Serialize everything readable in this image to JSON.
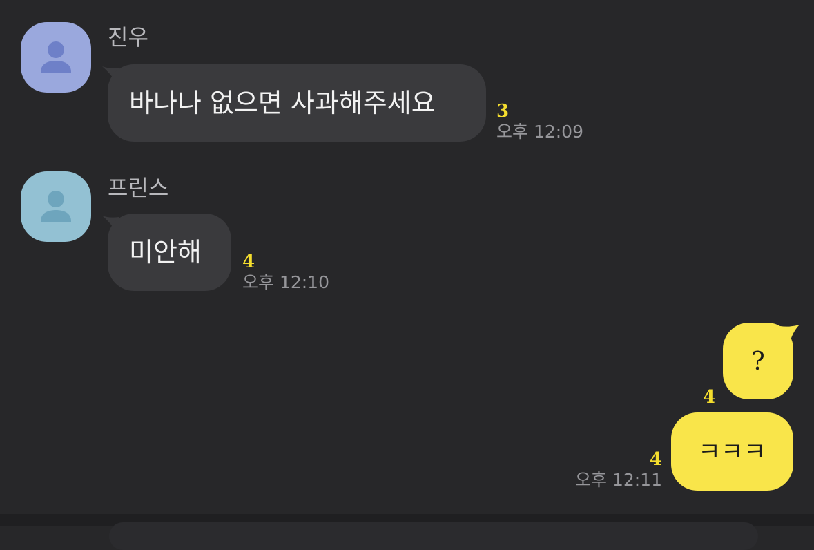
{
  "colors": {
    "background": "#272729",
    "incoming_bubble": "#3a3a3d",
    "outgoing_bubble": "#f9e54a",
    "unread_count": "#f4dd2e",
    "timestamp": "#96969a",
    "avatar_jinwoo": "#9aa8dd",
    "avatar_prince": "#93c1d3"
  },
  "messages": [
    {
      "sender": "진우",
      "avatar_icon": "person-icon",
      "text": "바나나 없으면 사과해주세요",
      "unread": "3",
      "time": "오후 12:09"
    },
    {
      "sender": "프린스",
      "avatar_icon": "person-icon",
      "text": "미안해",
      "unread": "4",
      "time": "오후 12:10"
    },
    {
      "text": "?",
      "unread": "4"
    },
    {
      "text": "ㅋㅋㅋ",
      "unread": "4",
      "time": "오후 12:11"
    }
  ]
}
